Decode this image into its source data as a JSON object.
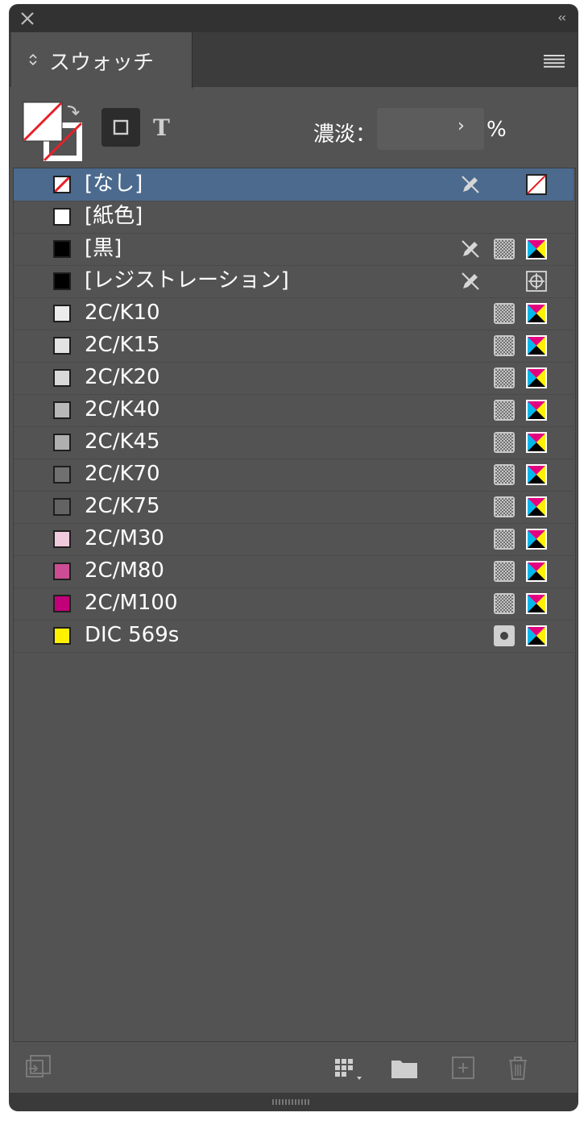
{
  "panel": {
    "tab_label": "スウォッチ",
    "collapse_label": "‹‹"
  },
  "controls": {
    "tint_label": "濃淡：",
    "tint_value": "",
    "tint_percent": "%",
    "text_button_label": "T"
  },
  "swatches": [
    {
      "name": "[なし]",
      "chip": "none",
      "selected": true,
      "edit_locked": true,
      "type": "",
      "mode": "none"
    },
    {
      "name": "[紙色]",
      "chip": "#ffffff",
      "selected": false,
      "edit_locked": false,
      "type": "",
      "mode": ""
    },
    {
      "name": "[黒]",
      "chip": "#000000",
      "selected": false,
      "edit_locked": true,
      "type": "process",
      "mode": "cmyk"
    },
    {
      "name": "[レジストレーション]",
      "chip": "#000000",
      "selected": false,
      "edit_locked": true,
      "type": "",
      "mode": "registration"
    },
    {
      "name": "2C/K10",
      "chip": "#ececec",
      "selected": false,
      "edit_locked": false,
      "type": "process",
      "mode": "cmyk"
    },
    {
      "name": "2C/K15",
      "chip": "#e3e3e3",
      "selected": false,
      "edit_locked": false,
      "type": "process",
      "mode": "cmyk"
    },
    {
      "name": "2C/K20",
      "chip": "#d9d9d9",
      "selected": false,
      "edit_locked": false,
      "type": "process",
      "mode": "cmyk"
    },
    {
      "name": "2C/K40",
      "chip": "#b8b8b8",
      "selected": false,
      "edit_locked": false,
      "type": "process",
      "mode": "cmyk"
    },
    {
      "name": "2C/K45",
      "chip": "#afafaf",
      "selected": false,
      "edit_locked": false,
      "type": "process",
      "mode": "cmyk"
    },
    {
      "name": "2C/K70",
      "chip": "#707070",
      "selected": false,
      "edit_locked": false,
      "type": "process",
      "mode": "cmyk"
    },
    {
      "name": "2C/K75",
      "chip": "#636363",
      "selected": false,
      "edit_locked": false,
      "type": "process",
      "mode": "cmyk"
    },
    {
      "name": "2C/M30",
      "chip": "#efc9dc",
      "selected": false,
      "edit_locked": false,
      "type": "process",
      "mode": "cmyk"
    },
    {
      "name": "2C/M80",
      "chip": "#cc4d93",
      "selected": false,
      "edit_locked": false,
      "type": "process",
      "mode": "cmyk"
    },
    {
      "name": "2C/M100",
      "chip": "#c2007a",
      "selected": false,
      "edit_locked": false,
      "type": "process",
      "mode": "cmyk"
    },
    {
      "name": "DIC 569s",
      "chip": "#fff100",
      "selected": false,
      "edit_locked": false,
      "type": "spot",
      "mode": "cmyk"
    }
  ],
  "colors": {
    "panel_bg": "#535353",
    "selected_row": "#4b6a8e",
    "none_red": "#e8202a"
  },
  "icons": {
    "close": "close-icon",
    "menu": "panel-menu-icon",
    "fill_stroke": "fill-stroke-icon",
    "swap": "swap-arrows-icon",
    "container": "container-formatting-icon",
    "text": "text-formatting-icon",
    "edit_locked": "pencil-crossed-icon",
    "process": "process-color-icon",
    "spot": "spot-color-icon",
    "cmyk": "cmyk-mode-icon",
    "registration": "registration-target-icon",
    "bottom": [
      "show-swatch-kinds-icon",
      "swatch-views-icon",
      "new-color-group-icon",
      "new-swatch-icon",
      "delete-swatch-icon"
    ]
  }
}
